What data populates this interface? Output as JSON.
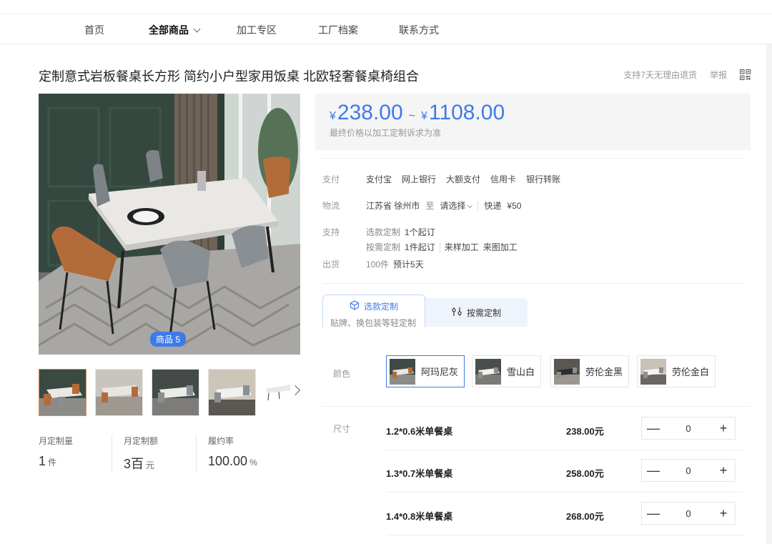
{
  "nav": {
    "items": [
      {
        "label": "首页"
      },
      {
        "label": "全部商品"
      },
      {
        "label": "加工专区"
      },
      {
        "label": "工厂档案"
      },
      {
        "label": "联系方式"
      }
    ]
  },
  "product": {
    "title": "定制意式岩板餐桌长方形 简约小户型家用饭桌 北欧轻奢餐桌椅组合",
    "return_policy": "支持7天无理由退货",
    "report": "举报",
    "image_badge": "商品 5"
  },
  "price": {
    "currency": "¥",
    "min": "238.00",
    "tilde": "~",
    "max": "1108.00",
    "note": "最终价格以加工定制诉求为准"
  },
  "payment": {
    "label": "支付",
    "methods": [
      "支付宝",
      "网上银行",
      "大额支付",
      "信用卡",
      "银行转账"
    ]
  },
  "logistics": {
    "label": "物流",
    "from": "江苏省 徐州市",
    "to_word": "至",
    "select": "请选择",
    "express": "快递",
    "fee": "¥50"
  },
  "support": {
    "label": "支持",
    "line1_type": "选款定制",
    "line1_min": "1个起订",
    "line2_type": "按需定制",
    "line2_min": "1件起订",
    "line2_opt1": "来样加工",
    "line2_opt2": "来图加工"
  },
  "shipping": {
    "label": "出货",
    "qty": "100件",
    "eta": "预计5天"
  },
  "tabs": {
    "tab1_label": "选款定制",
    "tab1_sub": "贴牌、换包装等轻定制",
    "tab2_label": "按需定制"
  },
  "colors": {
    "label": "颜色",
    "options": [
      {
        "name": "阿玛尼灰"
      },
      {
        "name": "雪山白"
      },
      {
        "name": "劳伦金黑"
      },
      {
        "name": "劳伦金白"
      }
    ]
  },
  "sizes": {
    "label": "尺寸",
    "rows": [
      {
        "name": "1.2*0.6米单餐桌",
        "price": "238.00元",
        "qty": "0"
      },
      {
        "name": "1.3*0.7米单餐桌",
        "price": "258.00元",
        "qty": "0"
      },
      {
        "name": "1.4*0.8米单餐桌",
        "price": "268.00元",
        "qty": "0"
      }
    ]
  },
  "stats": {
    "items": [
      {
        "label": "月定制量",
        "value": "1",
        "unit": "件"
      },
      {
        "label": "月定制额",
        "value": "3百",
        "unit": "元"
      },
      {
        "label": "履约率",
        "value": "100.00",
        "unit": "%"
      }
    ]
  },
  "icons": {
    "dropdown": "chevron-down-icon",
    "qr": "qr-code-icon",
    "arrow": "chevron-right-icon",
    "cube": "cube-icon",
    "sliders": "sliders-icon",
    "minus": "minus-icon",
    "plus": "plus-icon"
  },
  "colors_theme": {
    "accent": "#3f7be8",
    "selected_thumb_border": "#e28a4a"
  }
}
